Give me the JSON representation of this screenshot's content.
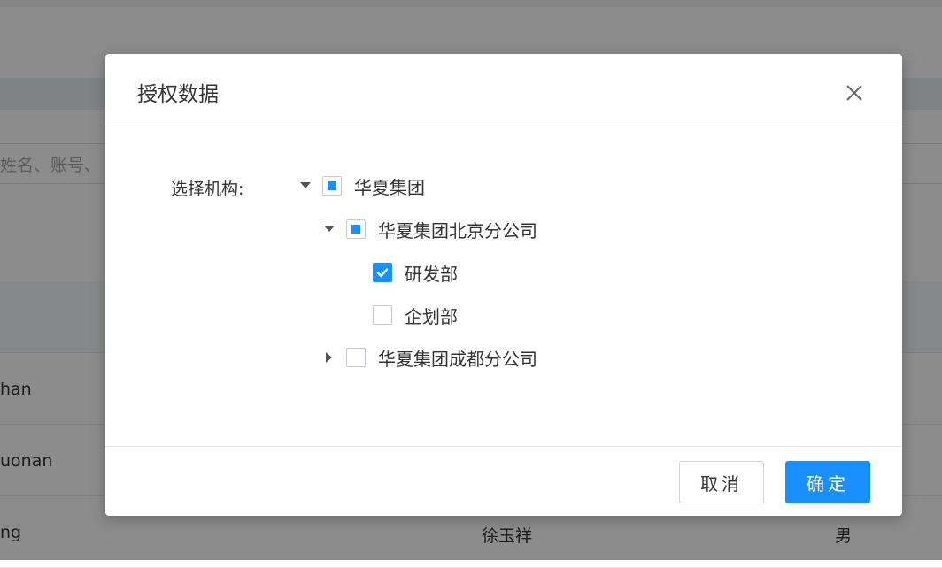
{
  "background": {
    "search_placeholder": "姓名、账号、",
    "rows": [
      {
        "account": "han",
        "name": "",
        "gender": ""
      },
      {
        "account": "uonan",
        "name": "",
        "gender": ""
      },
      {
        "account": "ng",
        "name": "徐玉祥",
        "gender": "男"
      }
    ]
  },
  "dialog": {
    "title": "授权数据",
    "field_label": "选择机构:",
    "tree": [
      {
        "label": "华夏集团",
        "state": "indeterminate",
        "expanded": true,
        "level": 0
      },
      {
        "label": "华夏集团北京分公司",
        "state": "indeterminate",
        "expanded": true,
        "level": 1
      },
      {
        "label": "研发部",
        "state": "checked",
        "leaf": true,
        "level": 2
      },
      {
        "label": "企划部",
        "state": "unchecked",
        "leaf": true,
        "level": 2
      },
      {
        "label": "华夏集团成都分公司",
        "state": "unchecked",
        "expanded": false,
        "level": 1
      }
    ],
    "buttons": {
      "cancel": "取消",
      "ok": "确定"
    }
  },
  "colors": {
    "primary": "#1890ff",
    "overlay": "rgba(0,0,0,0.45)"
  },
  "icons": {
    "close": "close-icon",
    "caret_expanded": "caret-down-icon",
    "caret_collapsed": "caret-right-icon",
    "check": "check-icon"
  }
}
